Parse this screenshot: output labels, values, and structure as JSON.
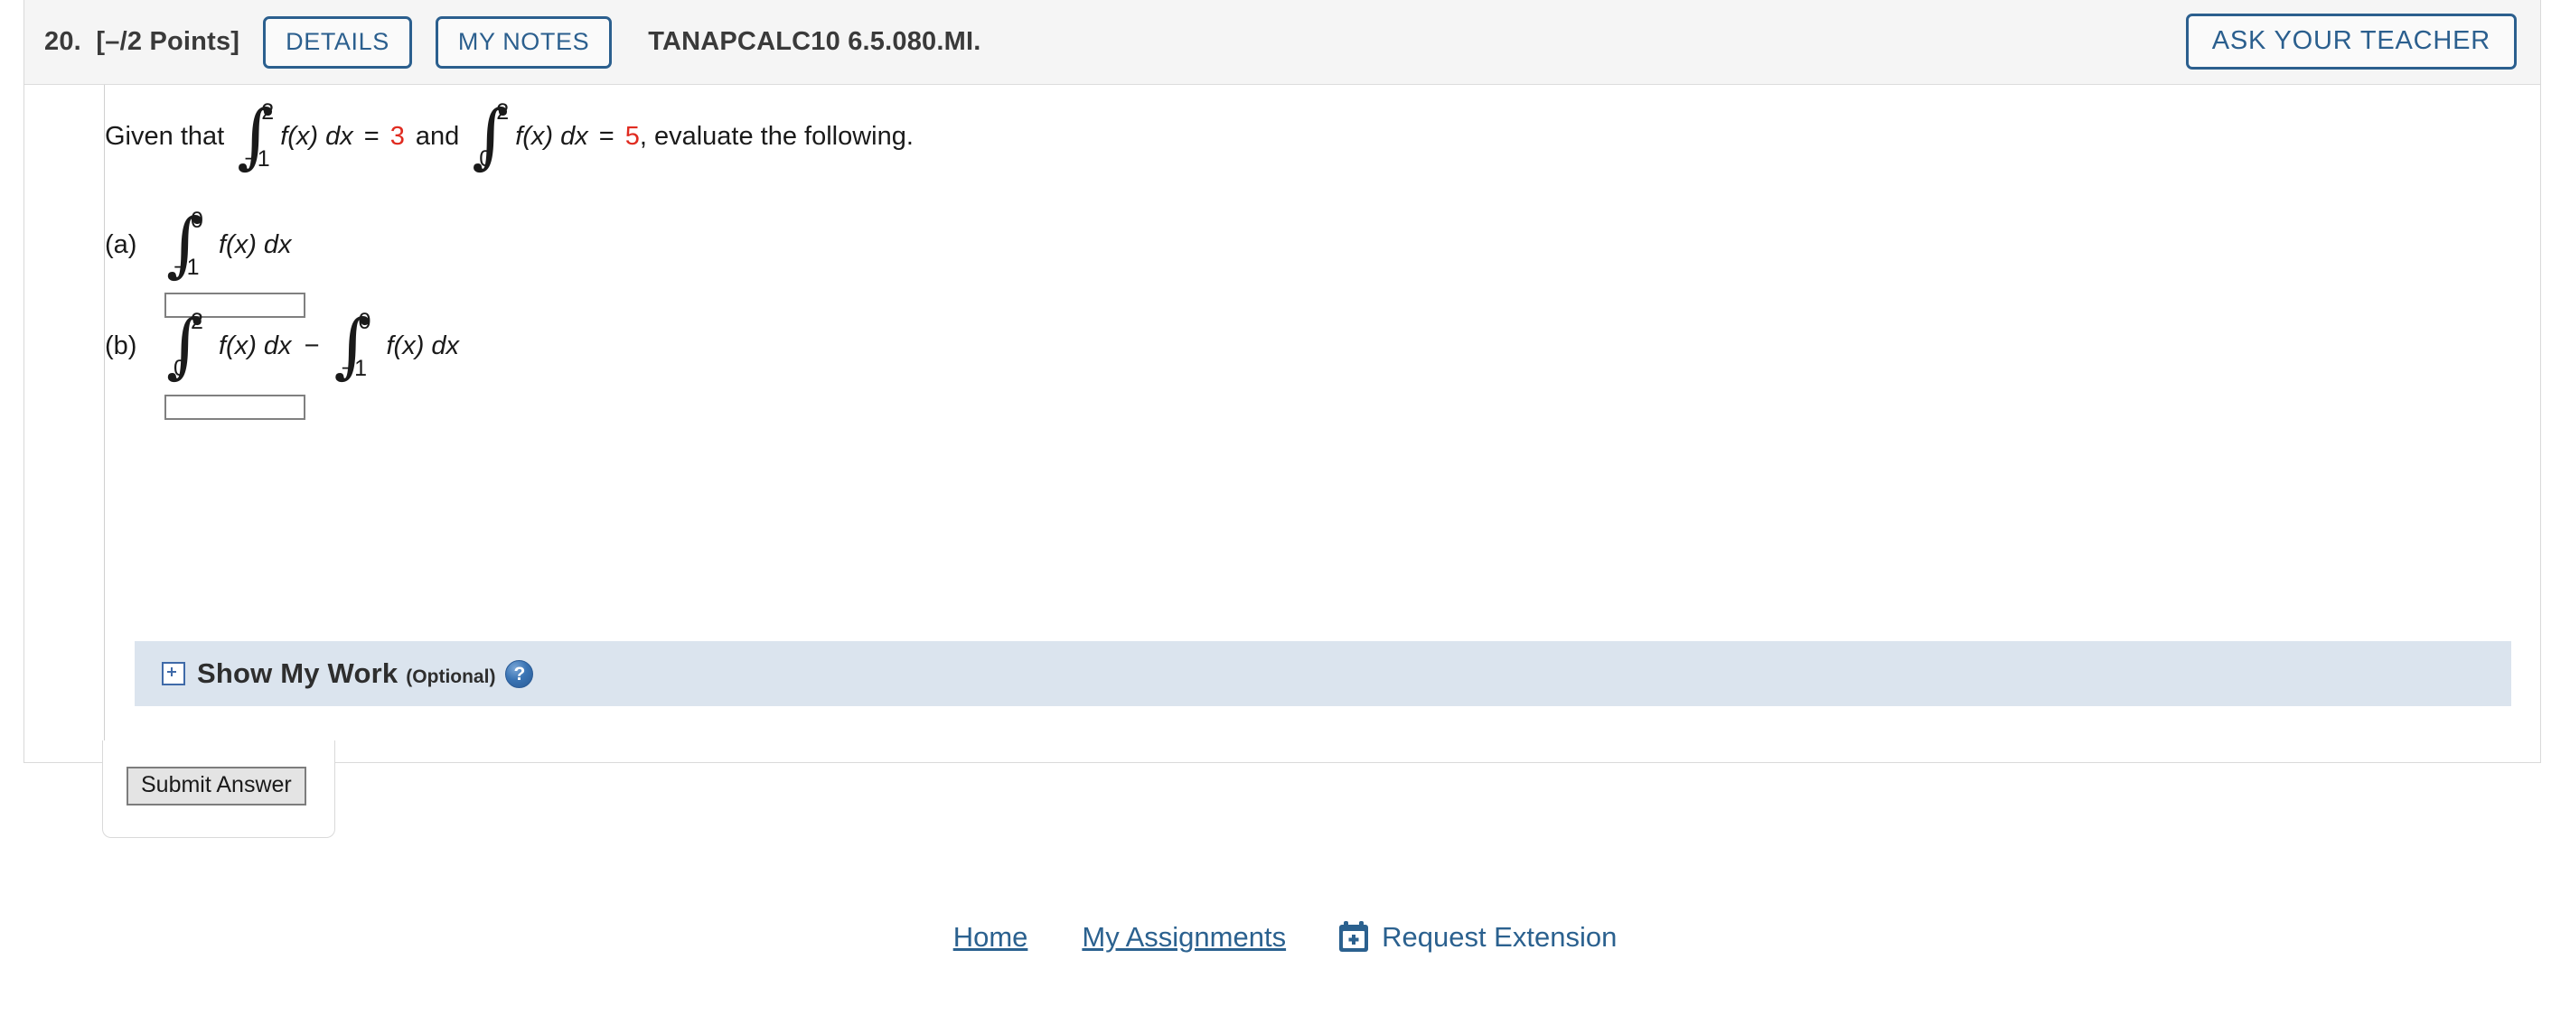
{
  "header": {
    "points_label": "20.  [–/2 Points]",
    "details_label": "DETAILS",
    "my_notes_label": "MY NOTES",
    "assignment_code": "TANAPCALC10 6.5.080.MI.",
    "ask_teacher_label": "ASK YOUR TEACHER"
  },
  "problem": {
    "given_prefix": "Given that",
    "integral1": {
      "upper": "2",
      "lower": "−1",
      "integrand": "f(x) dx"
    },
    "equals": "=",
    "value1": "3",
    "conjunction": "and",
    "integral2": {
      "upper": "2",
      "lower": "0",
      "integrand": "f(x) dx"
    },
    "value2": "5",
    "suffix": ", evaluate the following."
  },
  "parts": [
    {
      "label": "(a)",
      "terms": [
        {
          "upper": "0",
          "lower": "−1",
          "integrand": "f(x) dx"
        }
      ],
      "operator": "",
      "answer_value": ""
    },
    {
      "label": "(b)",
      "terms": [
        {
          "upper": "2",
          "lower": "0",
          "integrand": "f(x) dx"
        },
        {
          "upper": "0",
          "lower": "−1",
          "integrand": "f(x) dx"
        }
      ],
      "operator": "−",
      "answer_value": ""
    }
  ],
  "show_my_work": {
    "expand_icon": "plus-box-icon",
    "title": "Show My Work",
    "optional": "(Optional)",
    "help_icon": "?"
  },
  "submit": {
    "label": "Submit Answer"
  },
  "footer": {
    "home": "Home",
    "my_assignments": "My Assignments",
    "request_extension": "Request Extension",
    "calendar_icon": "calendar-plus-icon"
  },
  "colors": {
    "accent_blue": "#2b5f8e",
    "link_blue": "#2b618f",
    "value_red": "#e02b20",
    "header_bg": "#f5f5f5",
    "show_work_bg": "#dbe4ee"
  }
}
